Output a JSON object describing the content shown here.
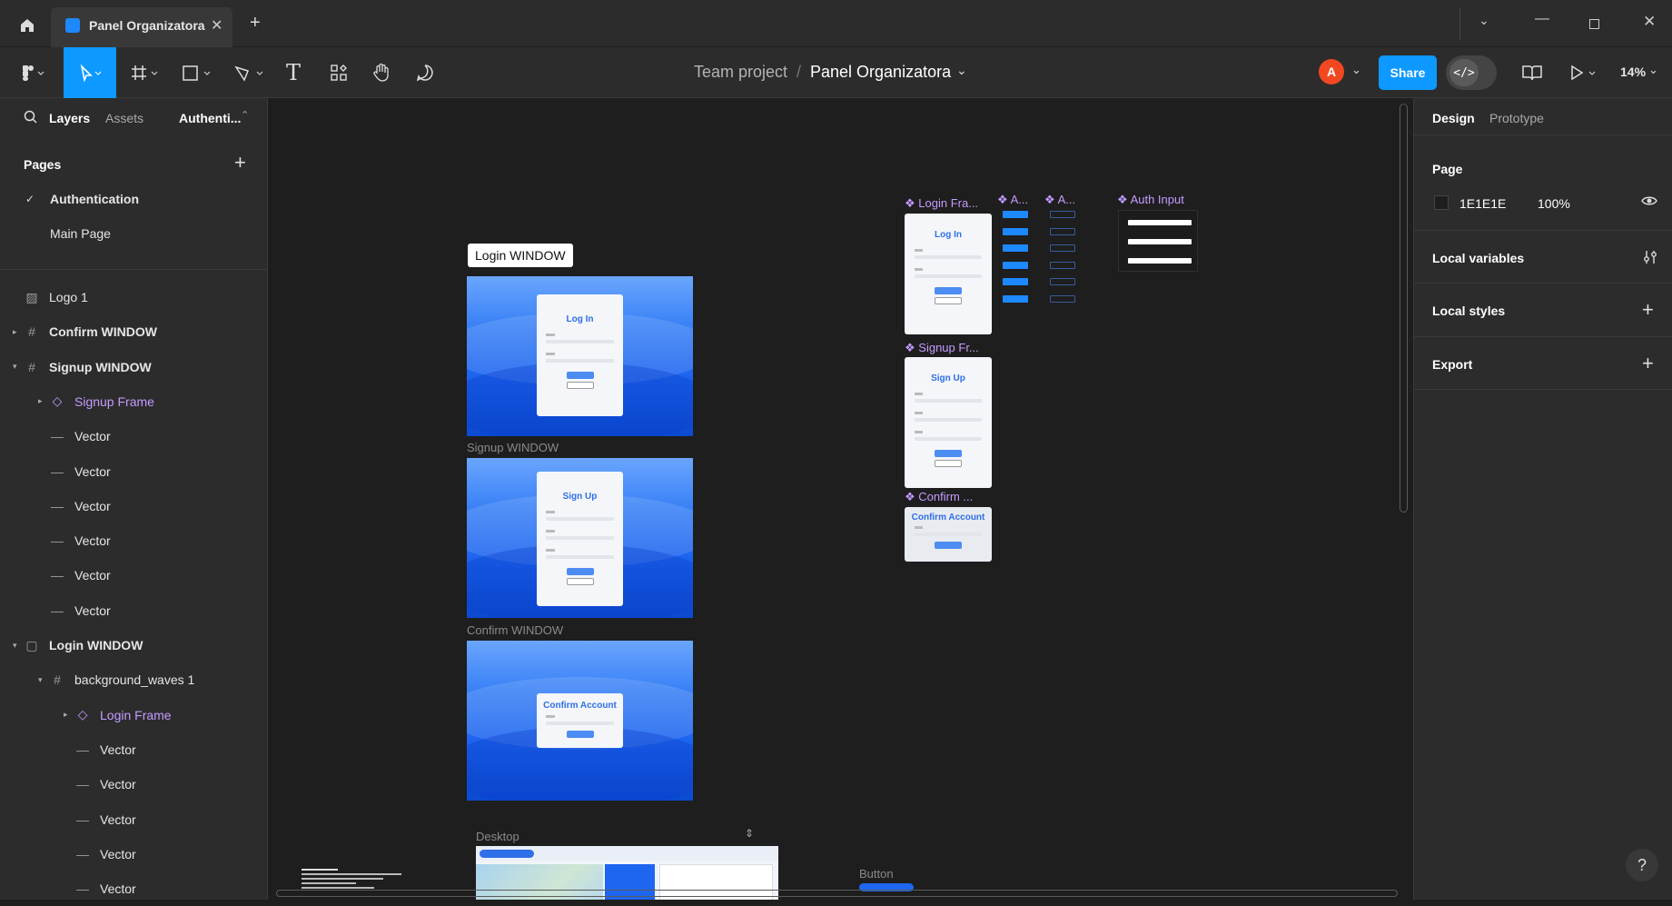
{
  "tab": {
    "title": "Panel Organizatora"
  },
  "breadcrumb": {
    "team": "Team project",
    "separator": "/",
    "file": "Panel Organizatora"
  },
  "toolbar": {
    "avatar": "A",
    "share": "Share",
    "zoom": "14%"
  },
  "left_panel": {
    "tab_layers": "Layers",
    "tab_assets": "Assets",
    "tab_page": "Authenti...",
    "pages_title": "Pages",
    "pages": [
      {
        "label": "Authentication",
        "active": true
      },
      {
        "label": "Main Page",
        "active": false
      }
    ],
    "layers": [
      {
        "label": "Logo 1",
        "indent": 0,
        "icon": "image-icon",
        "expand": "",
        "component": false,
        "bold": false
      },
      {
        "label": "Confirm WINDOW",
        "indent": 0,
        "icon": "frame-icon",
        "expand": "▸",
        "component": false,
        "bold": true
      },
      {
        "label": "Signup WINDOW",
        "indent": 0,
        "icon": "frame-icon",
        "expand": "▾",
        "component": false,
        "bold": true
      },
      {
        "label": "Signup Frame",
        "indent": 1,
        "icon": "instance-icon",
        "expand": "▸",
        "component": true,
        "bold": false
      },
      {
        "label": "Vector",
        "indent": 1,
        "icon": "vector-icon",
        "expand": "",
        "component": false,
        "bold": false
      },
      {
        "label": "Vector",
        "indent": 1,
        "icon": "vector-icon",
        "expand": "",
        "component": false,
        "bold": false
      },
      {
        "label": "Vector",
        "indent": 1,
        "icon": "vector-icon",
        "expand": "",
        "component": false,
        "bold": false
      },
      {
        "label": "Vector",
        "indent": 1,
        "icon": "vector-icon",
        "expand": "",
        "component": false,
        "bold": false
      },
      {
        "label": "Vector",
        "indent": 1,
        "icon": "vector-icon",
        "expand": "",
        "component": false,
        "bold": false
      },
      {
        "label": "Vector",
        "indent": 1,
        "icon": "vector-icon",
        "expand": "",
        "component": false,
        "bold": false
      },
      {
        "label": "Login WINDOW",
        "indent": 0,
        "icon": "section-icon",
        "expand": "▾",
        "component": false,
        "bold": true
      },
      {
        "label": "background_waves 1",
        "indent": 1,
        "icon": "frame-icon",
        "expand": "▾",
        "component": false,
        "bold": false
      },
      {
        "label": "Login Frame",
        "indent": 2,
        "icon": "instance-icon",
        "expand": "▸",
        "component": true,
        "bold": false
      },
      {
        "label": "Vector",
        "indent": 2,
        "icon": "vector-icon",
        "expand": "",
        "component": false,
        "bold": false
      },
      {
        "label": "Vector",
        "indent": 2,
        "icon": "vector-icon",
        "expand": "",
        "component": false,
        "bold": false
      },
      {
        "label": "Vector",
        "indent": 2,
        "icon": "vector-icon",
        "expand": "",
        "component": false,
        "bold": false
      },
      {
        "label": "Vector",
        "indent": 2,
        "icon": "vector-icon",
        "expand": "",
        "component": false,
        "bold": false
      },
      {
        "label": "Vector",
        "indent": 2,
        "icon": "vector-icon",
        "expand": "",
        "component": false,
        "bold": false
      }
    ]
  },
  "right_panel": {
    "tab_design": "Design",
    "tab_prototype": "Prototype",
    "page_title": "Page",
    "page_color": "1E1E1E",
    "page_opacity": "100%",
    "local_variables": "Local variables",
    "local_styles": "Local styles",
    "export": "Export"
  },
  "canvas": {
    "login_window_label": "Login WINDOW",
    "signup_window_label": "Signup WINDOW",
    "confirm_window_label": "Confirm WINDOW",
    "login_card_title": "Log In",
    "signup_card_title": "Sign Up",
    "confirm_card_title": "Confirm Account",
    "comp_login": "Login Fra...",
    "comp_a1": "A...",
    "comp_a2": "A...",
    "comp_auth_input": "Auth Input",
    "comp_signup": "Signup Fr...",
    "comp_confirm": "Confirm ...",
    "desktop_label": "Desktop",
    "button_label": "Button",
    "help": "?"
  },
  "colors": {
    "accent": "#0d99ff",
    "component": "#c49bff",
    "avatar": "#f24822"
  }
}
